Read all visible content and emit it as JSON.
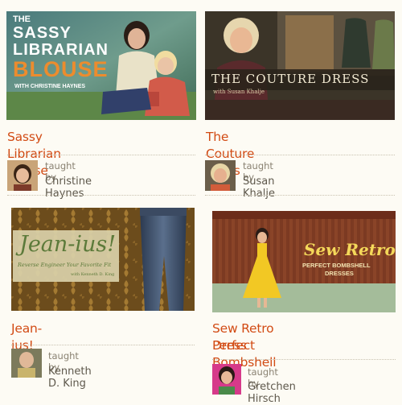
{
  "courses": [
    {
      "title": "Sassy Librarian Blouse",
      "thumb_line1": "THE",
      "thumb_line2": "SASSY",
      "thumb_line3": "LIBRARIAN",
      "thumb_line4": "BLOUSE",
      "thumb_line5": "WITH CHRISTINE HAYNES",
      "taught_by": "taught by",
      "instructor": "Christine Haynes"
    },
    {
      "title": "The Couture Dress",
      "thumb_line1": "THE COUTURE DRESS",
      "thumb_line2": "with Susan Khalje",
      "taught_by": "taught by",
      "instructor": "Susan Khalje"
    },
    {
      "title": "Jean-ius!",
      "thumb_line1": "Jean-ius!",
      "thumb_line2": "Reverse Engineer Your Favorite Fit",
      "thumb_line3": "with Kenneth D. King",
      "taught_by": "taught by",
      "instructor": "Kenneth D. King"
    },
    {
      "title_line1": "Sew Retro Perfect Bombshell",
      "title_line2": "Dress",
      "thumb_line1": "Sew Retro",
      "thumb_line2": "PERFECT BOMBSHELL",
      "thumb_line3": "DRESSES",
      "taught_by": "taught by",
      "instructor": "Gretchen Hirsch"
    }
  ],
  "colors": {
    "title_orange": "#d24b14",
    "page_bg": "#fdfbf4",
    "divider": "#c9c2b0"
  }
}
